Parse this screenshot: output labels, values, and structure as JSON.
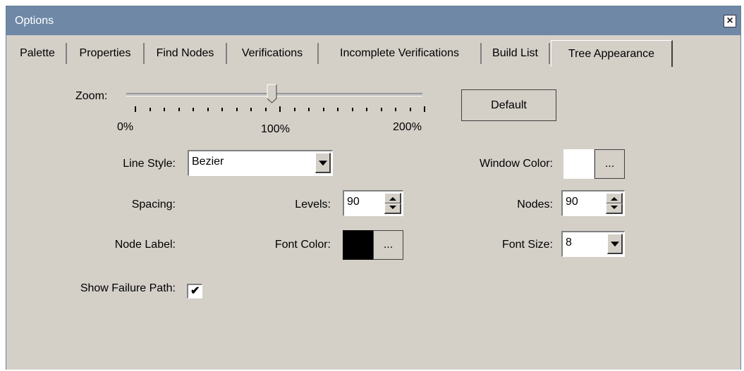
{
  "window": {
    "title": "Options"
  },
  "tabs": [
    {
      "label": "Palette"
    },
    {
      "label": "Properties"
    },
    {
      "label": "Find Nodes"
    },
    {
      "label": "Verifications"
    },
    {
      "label": "Incomplete Verifications"
    },
    {
      "label": "Build List"
    },
    {
      "label": "Tree Appearance"
    }
  ],
  "active_tab": "Tree Appearance",
  "zoom": {
    "label": "Zoom:",
    "min_label": "0%",
    "mid_label": "100%",
    "max_label": "200%",
    "value_percent": 100
  },
  "default_button": "Default",
  "line_style": {
    "label": "Line Style:",
    "value": "Bezier"
  },
  "window_color": {
    "label": "Window Color:",
    "color": "#ffffff",
    "button": "..."
  },
  "spacing": {
    "label": "Spacing:",
    "levels_label": "Levels:",
    "levels_value": "90",
    "nodes_label": "Nodes:",
    "nodes_value": "90"
  },
  "node_label": {
    "label": "Node Label:",
    "font_color_label": "Font Color:",
    "font_color": "#000000",
    "font_color_button": "...",
    "font_size_label": "Font Size:",
    "font_size_value": "8"
  },
  "show_failure_path": {
    "label": "Show Failure Path:",
    "checked": true
  }
}
